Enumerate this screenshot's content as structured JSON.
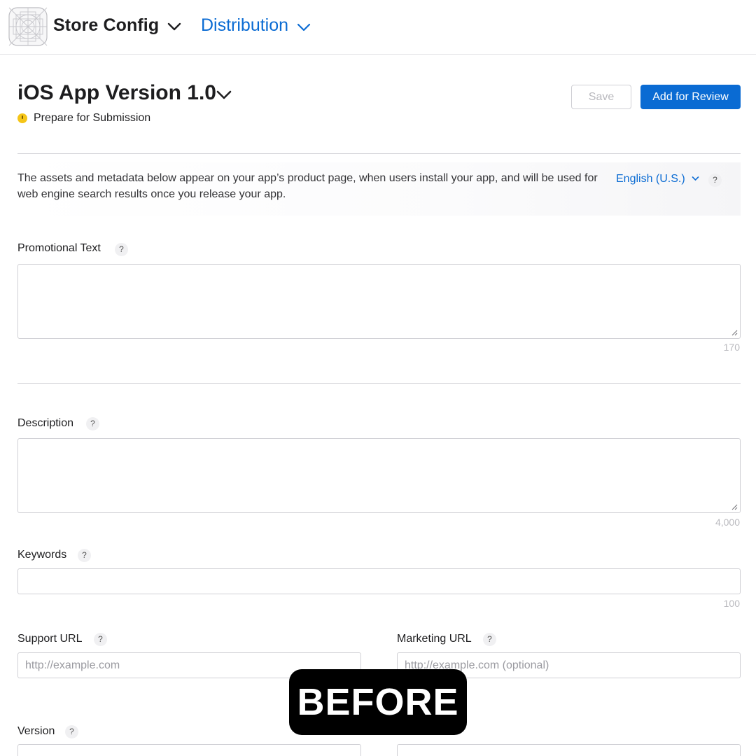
{
  "topbar": {
    "app_name": "Store Config",
    "nav_distribution": "Distribution"
  },
  "header": {
    "version_title": "iOS App Version 1.0",
    "status": "Prepare for Submission",
    "status_color": "#f5c518",
    "save_label": "Save",
    "add_review_label": "Add for Review"
  },
  "banner": {
    "text": "The assets and metadata below appear on your app’s product page, when users install your app, and will be used for web engine search results once you release your app.",
    "language": "English (U.S.)",
    "help": "?"
  },
  "fields": {
    "promotional_text": {
      "label": "Promotional Text",
      "help": "?",
      "value": "",
      "char_limit": "170"
    },
    "description": {
      "label": "Description",
      "help": "?",
      "value": "",
      "char_limit": "4,000"
    },
    "keywords": {
      "label": "Keywords",
      "help": "?",
      "value": "",
      "char_limit": "100"
    },
    "support_url": {
      "label": "Support URL",
      "help": "?",
      "value": "",
      "placeholder": "http://example.com"
    },
    "marketing_url": {
      "label": "Marketing URL",
      "help": "?",
      "value": "",
      "placeholder": "http://example.com (optional)"
    },
    "version": {
      "label": "Version",
      "help": "?"
    }
  },
  "overlay": {
    "label": "BEFORE"
  },
  "colors": {
    "accent": "#0a6bd3",
    "primary_button": "#0a6bd3",
    "text": "#1d1d1f",
    "muted": "#b9b9be"
  }
}
